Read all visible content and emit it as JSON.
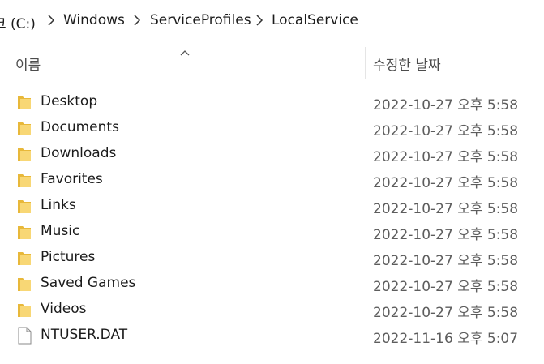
{
  "breadcrumb": {
    "items": [
      {
        "label": "크 (C:)"
      },
      {
        "label": "Windows"
      },
      {
        "label": "ServiceProfiles"
      },
      {
        "label": "LocalService"
      }
    ]
  },
  "columns": {
    "name": "이름",
    "modified": "수정한 날짜",
    "sort": "ascending"
  },
  "files": [
    {
      "name": "Desktop",
      "modified": "2022-10-27 오후 5:58",
      "type": "folder",
      "icon": "folder-icon"
    },
    {
      "name": "Documents",
      "modified": "2022-10-27 오후 5:58",
      "type": "folder",
      "icon": "folder-icon"
    },
    {
      "name": "Downloads",
      "modified": "2022-10-27 오후 5:58",
      "type": "folder",
      "icon": "folder-icon"
    },
    {
      "name": "Favorites",
      "modified": "2022-10-27 오후 5:58",
      "type": "folder",
      "icon": "folder-icon"
    },
    {
      "name": "Links",
      "modified": "2022-10-27 오후 5:58",
      "type": "folder",
      "icon": "folder-icon"
    },
    {
      "name": "Music",
      "modified": "2022-10-27 오후 5:58",
      "type": "folder",
      "icon": "folder-icon"
    },
    {
      "name": "Pictures",
      "modified": "2022-10-27 오후 5:58",
      "type": "folder",
      "icon": "folder-icon"
    },
    {
      "name": "Saved Games",
      "modified": "2022-10-27 오후 5:58",
      "type": "folder",
      "icon": "folder-icon"
    },
    {
      "name": "Videos",
      "modified": "2022-10-27 오후 5:58",
      "type": "folder",
      "icon": "folder-icon"
    },
    {
      "name": "NTUSER.DAT",
      "modified": "2022-11-16 오후 5:07",
      "type": "file",
      "icon": "file-icon"
    }
  ],
  "colors": {
    "folder": "#f8d775",
    "folder_dark": "#e8b83a",
    "date_text": "#5d5d5d"
  }
}
